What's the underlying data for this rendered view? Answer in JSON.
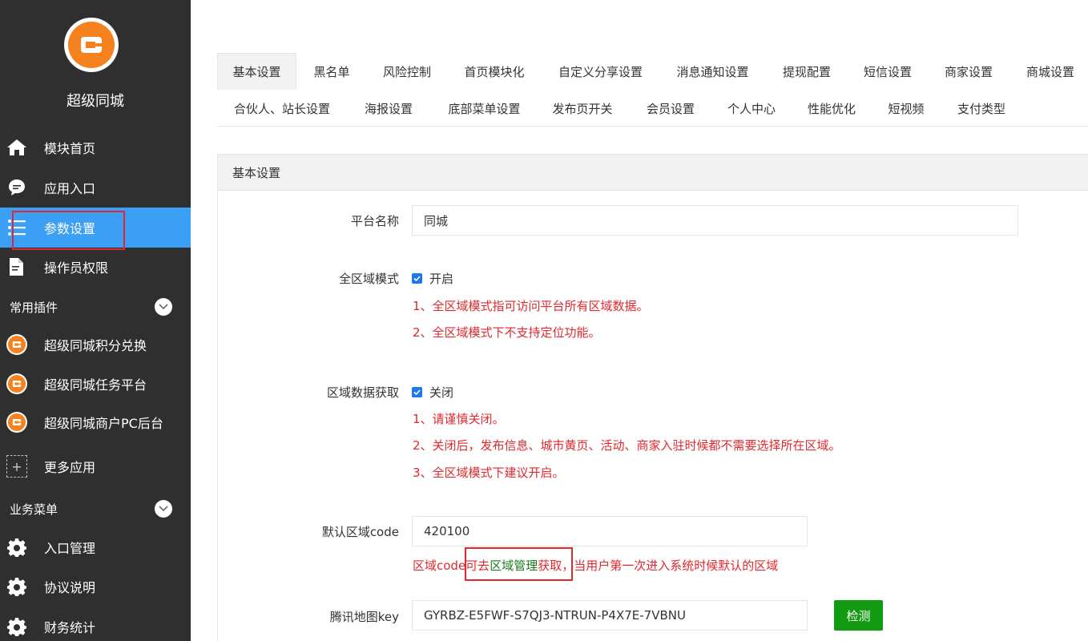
{
  "brand": {
    "name": "超级同城",
    "logo_color": "#f5821f"
  },
  "sidebar": {
    "bg_color": "#2f2f2f",
    "active_color": "#3a9ff5",
    "main_items": [
      {
        "label": "模块首页",
        "icon": "home-icon"
      },
      {
        "label": "应用入口",
        "icon": "chat-icon"
      },
      {
        "label": "参数设置",
        "icon": "list-icon",
        "active": true
      },
      {
        "label": "操作员权限",
        "icon": "document-edit-icon"
      }
    ],
    "plugin_group": {
      "label": "常用插件",
      "items": [
        {
          "label": "超级同城积分兑换"
        },
        {
          "label": "超级同城任务平台"
        },
        {
          "label": "超级同城商户PC后台"
        }
      ],
      "more_label": "更多应用"
    },
    "business_group": {
      "label": "业务菜单",
      "items": [
        {
          "label": "入口管理",
          "icon": "gear-icon"
        },
        {
          "label": "协议说明",
          "icon": "gear-icon"
        },
        {
          "label": "财务统计",
          "icon": "gear-icon"
        }
      ]
    }
  },
  "tabs": {
    "row1": [
      "基本设置",
      "黑名单",
      "风险控制",
      "首页模块化",
      "自定义分享设置",
      "消息通知设置",
      "提现配置",
      "短信设置",
      "商家设置",
      "商城设置"
    ],
    "row2": [
      "合伙人、站长设置",
      "海报设置",
      "底部菜单设置",
      "发布页开关",
      "会员设置",
      "个人中心",
      "性能优化",
      "短视频",
      "支付类型"
    ],
    "active": "基本设置"
  },
  "panel": {
    "title": "基本设置",
    "platform_name": {
      "label": "平台名称",
      "value": "同城"
    },
    "global_mode": {
      "label": "全区域模式",
      "checkbox_label": "开启",
      "notes": [
        "1、全区域模式指可访问平台所有区域数据。",
        "2、全区域模式下不支持定位功能。"
      ]
    },
    "region_fetch": {
      "label": "区域数据获取",
      "checkbox_label": "关闭",
      "notes": [
        "1、请谨慎关闭。",
        "2、关闭后，发布信息、城市黄页、活动、商家入驻时候都不需要选择所在区域。",
        "3、全区域模式下建议开启。"
      ]
    },
    "default_region": {
      "label": "默认区域code",
      "value": "420100",
      "hint_prefix": "区域code可去",
      "hint_link": "区域管理",
      "hint_suffix": "获取，当用户第一次进入系统时候默认的区域"
    },
    "map_key": {
      "label": "腾讯地图key",
      "value": "GYRBZ-E5FWF-S7QJ3-NTRUN-P4X7E-7VBNU",
      "button_label": "检测"
    }
  },
  "colors": {
    "note_red": "#e0282e",
    "link_green": "#1a7a1a",
    "check_button": "#129a12",
    "checkbox_blue": "#1e78e6"
  }
}
